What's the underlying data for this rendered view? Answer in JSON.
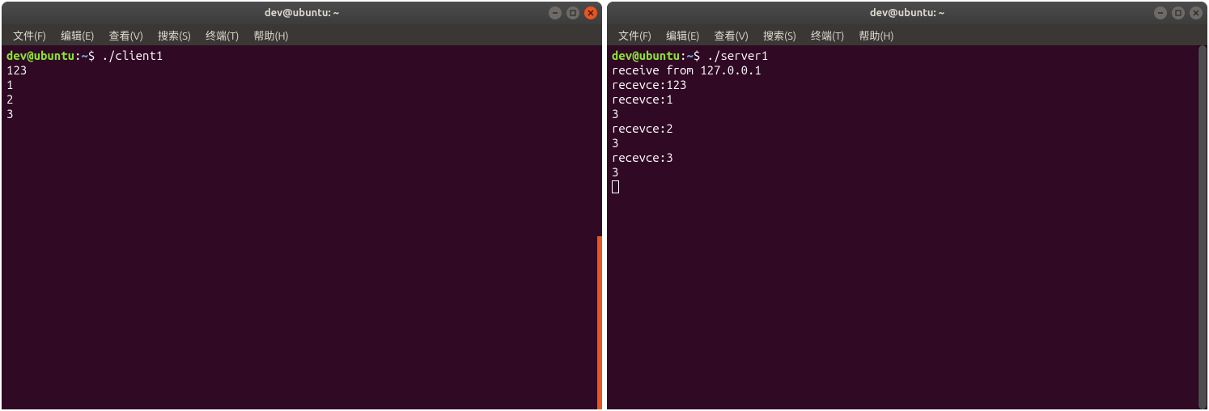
{
  "windows": [
    {
      "title": "dev@ubuntu: ~",
      "active": true,
      "menus": [
        "文件(F)",
        "编辑(E)",
        "查看(V)",
        "搜索(S)",
        "终端(T)",
        "帮助(H)"
      ],
      "prompt": {
        "user": "dev",
        "host": "ubuntu",
        "path": "~",
        "symbol": "$"
      },
      "command": "./client1",
      "output": [
        "123",
        "1",
        "2",
        "3"
      ],
      "show_cursor": false
    },
    {
      "title": "dev@ubuntu: ~",
      "active": false,
      "menus": [
        "文件(F)",
        "编辑(E)",
        "查看(V)",
        "搜索(S)",
        "终端(T)",
        "帮助(H)"
      ],
      "prompt": {
        "user": "dev",
        "host": "ubuntu",
        "path": "~",
        "symbol": "$"
      },
      "command": "./server1",
      "output": [
        "receive from 127.0.0.1",
        "recevce:123",
        "recevce:1",
        "3",
        "recevce:2",
        "3",
        "recevce:3",
        "3"
      ],
      "show_cursor": true
    }
  ]
}
